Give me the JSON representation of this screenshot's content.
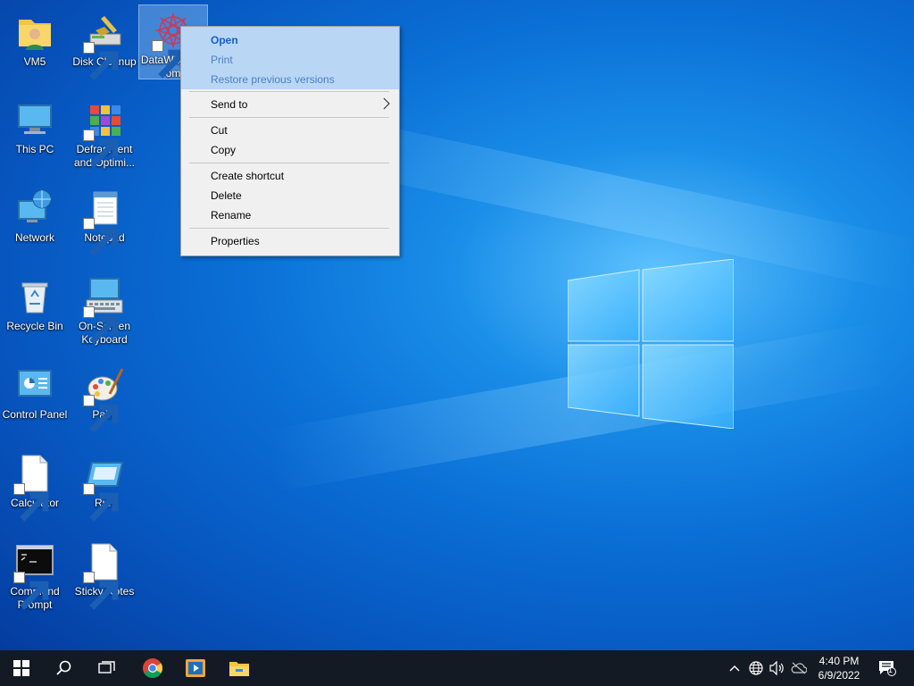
{
  "desktop": {
    "icons": [
      {
        "label": "VM5",
        "icon": "user-folder-icon"
      },
      {
        "label": "Disk Cleanup",
        "icon": "disk-cleanup-icon"
      },
      {
        "label": "DataWagon.com",
        "label_line1": "DataWagon.c",
        "label_line2": "om",
        "icon": "datawagon-icon"
      },
      {
        "label": "This PC",
        "icon": "computer-icon"
      },
      {
        "label": "Defragment and Optimi...",
        "label_line1": "Defragment",
        "label_line2": "and Optimi...",
        "icon": "defragment-icon"
      },
      {
        "label": "Network",
        "icon": "network-icon"
      },
      {
        "label": "Notepad",
        "icon": "notepad-icon"
      },
      {
        "label": "Recycle Bin",
        "icon": "recycle-bin-icon"
      },
      {
        "label": "On-Screen Keyboard",
        "label_line1": "On-Screen",
        "label_line2": "Keyboard",
        "icon": "keyboard-icon"
      },
      {
        "label": "Control Panel",
        "icon": "control-panel-icon"
      },
      {
        "label": "Paint",
        "icon": "paint-icon"
      },
      {
        "label": "Calculator",
        "icon": "blank-file-icon"
      },
      {
        "label": "Run",
        "icon": "run-icon"
      },
      {
        "label": "Command Prompt",
        "label_line1": "Command",
        "label_line2": "Prompt",
        "icon": "command-prompt-icon"
      },
      {
        "label": "Sticky Notes",
        "icon": "blank-file-icon"
      }
    ]
  },
  "context_menu": {
    "open": "Open",
    "print": "Print",
    "restore": "Restore previous versions",
    "send_to": "Send to",
    "cut": "Cut",
    "copy": "Copy",
    "create_shortcut": "Create shortcut",
    "delete": "Delete",
    "rename": "Rename",
    "properties": "Properties"
  },
  "taskbar": {
    "apps": [
      "start-icon",
      "search-icon",
      "task-view-icon",
      "chrome-icon",
      "media-player-icon",
      "file-explorer-icon"
    ],
    "clock_time": "4:40 PM",
    "clock_date": "6/9/2022",
    "notification_count": "1"
  },
  "colors": {
    "accent_blue": "#0a6fd6",
    "taskbar": "#131a24",
    "menu_background": "#f0f0f0",
    "menu_highlight": "#b9d6f5"
  }
}
